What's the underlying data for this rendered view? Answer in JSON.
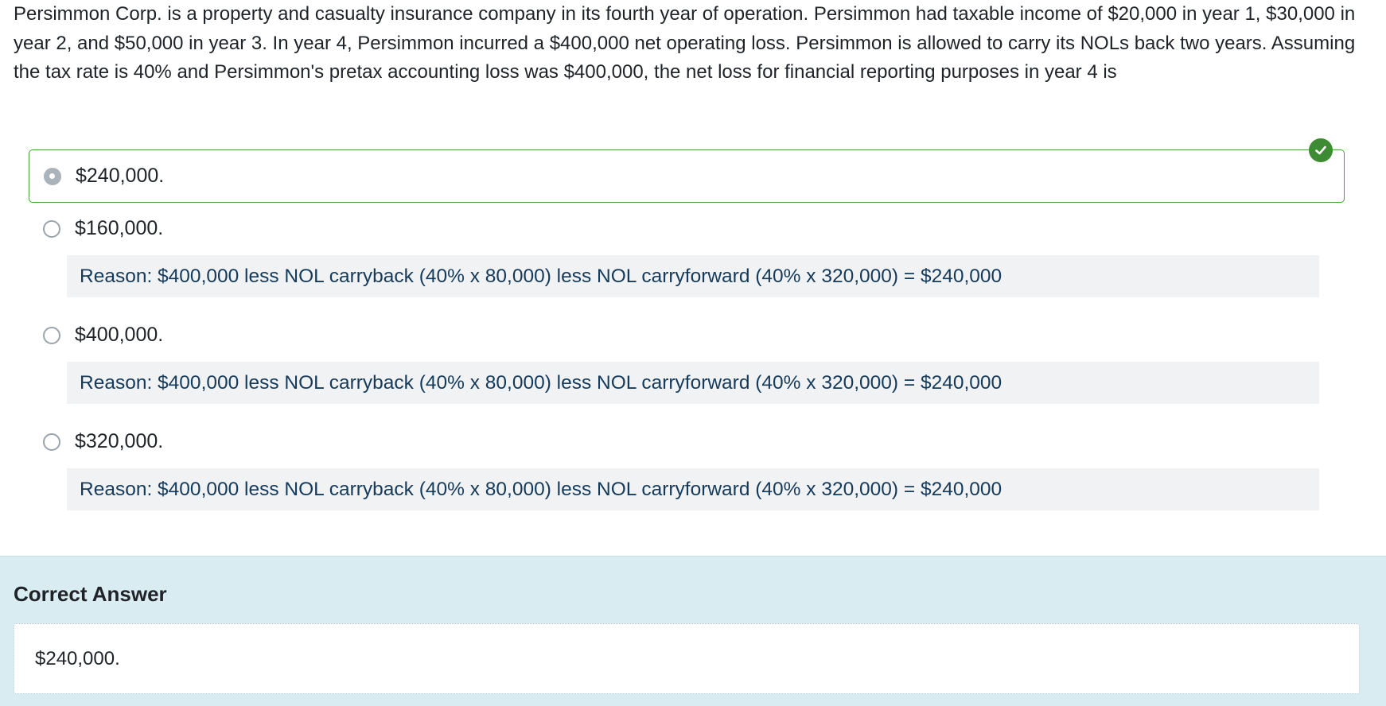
{
  "question": {
    "text": "Persimmon Corp. is a property and casualty insurance company in its fourth year of operation. Persimmon had taxable income of $20,000 in year 1, $30,000 in year 2, and $50,000 in year 3. In year 4, Persimmon incurred a $400,000 net operating loss. Persimmon is allowed to carry its NOLs back two years. Assuming the tax rate is 40% and Persimmon's pretax accounting loss was $400,000, the net loss for financial reporting purposes in year 4 is"
  },
  "options": [
    {
      "label": "$240,000.",
      "selected": true,
      "correct": true
    },
    {
      "label": "$160,000.",
      "selected": false,
      "reason": "Reason: $400,000 less NOL carryback (40% x 80,000) less NOL carryforward (40% x 320,000) = $240,000"
    },
    {
      "label": "$400,000.",
      "selected": false,
      "reason": "Reason: $400,000 less NOL carryback (40% x 80,000) less NOL carryforward (40% x 320,000) = $240,000"
    },
    {
      "label": "$320,000.",
      "selected": false,
      "reason": "Reason: $400,000 less NOL carryback (40% x 80,000) less NOL carryforward (40% x 320,000) = $240,000"
    }
  ],
  "correct_answer": {
    "title": "Correct Answer",
    "value": "$240,000."
  },
  "colors": {
    "correct_green": "#3d8b32",
    "panel_bg": "#d9ecf1",
    "reason_bg": "#f1f2f4"
  },
  "icons": {
    "correct_badge": "check-circle-icon"
  }
}
